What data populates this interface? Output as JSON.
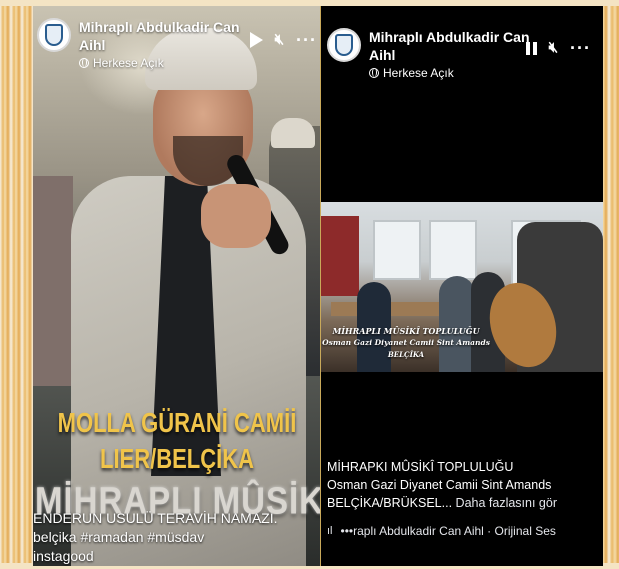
{
  "left_post": {
    "author": "Mihraplı Abdulkadir Can Aihl",
    "privacy": "Herkese Açık",
    "overlay_line1": "MOLLA GÜRANİ CAMİİ",
    "overlay_line2": "LIER/BELÇİKA",
    "overlay_big": "MİHRAPLI MÛSİKÎ",
    "caption_line1": "ENDERUN USULÜ TERAVİH NAMAZI.",
    "caption_line2": "belçika #ramadan #müsdav",
    "caption_line3": "instagood"
  },
  "right_post": {
    "author": "Mihraplı Abdulkadir Can Aihl",
    "privacy": "Herkese Açık",
    "video_text1": "MİHRAPLI MÛSİKÎ TOPLULUĞU",
    "video_text2": "Osman Gazi Diyanet Camii Sint Amands",
    "video_text3": "BELÇİKA",
    "caption_line1": "MİHRAPKI MÛSİKÎ TOPLULUĞU",
    "caption_line2": "Osman Gazi Diyanet Camii Sint Amands",
    "caption_line3": "BELÇİKA/BRÜKSEL...",
    "see_more": "Daha fazlasını gör",
    "audio": "•••raplı Abdulkadir Can Aihl · Orijinal Ses"
  },
  "icons": {
    "play": "play-icon",
    "pause": "pause-icon",
    "mute": "speaker-muted-icon",
    "more": "more-options-icon",
    "globe": "globe-icon",
    "music": "music-note-icon"
  },
  "colors": {
    "overlay_gold": "#f0c44a",
    "frame_orange": "#e9b866",
    "card_black": "#000000"
  }
}
